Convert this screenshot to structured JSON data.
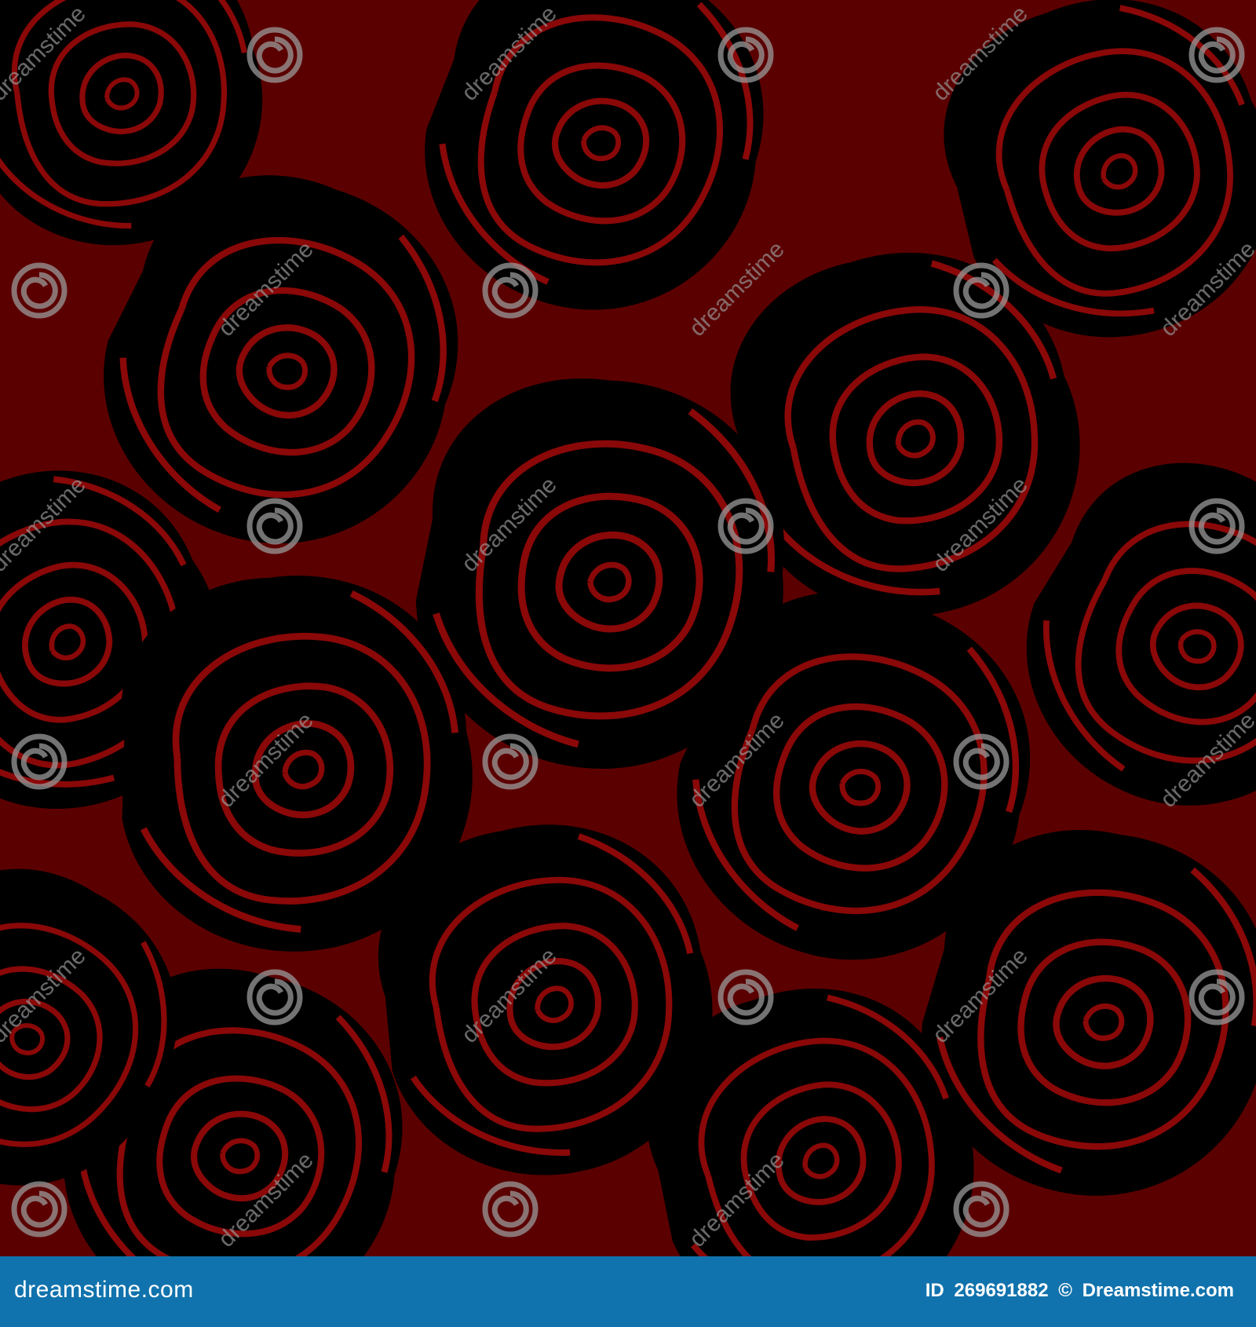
{
  "image": {
    "subject": "seamless pattern",
    "background_color": "#5b0000",
    "rose_fill_color": "#000000",
    "outline_color": "#8a0808",
    "watermark_color": "#9a9a9a",
    "watermark_text": "dreamstime",
    "watermark_icon": "spiral-logo-icon"
  },
  "footer": {
    "background_color": "#1173ad",
    "brand_text": "dreamstime.com",
    "id_label": "ID",
    "id_value": "269691882",
    "copyright_symbol": "©",
    "credit_text": "Dreamstime.com"
  }
}
